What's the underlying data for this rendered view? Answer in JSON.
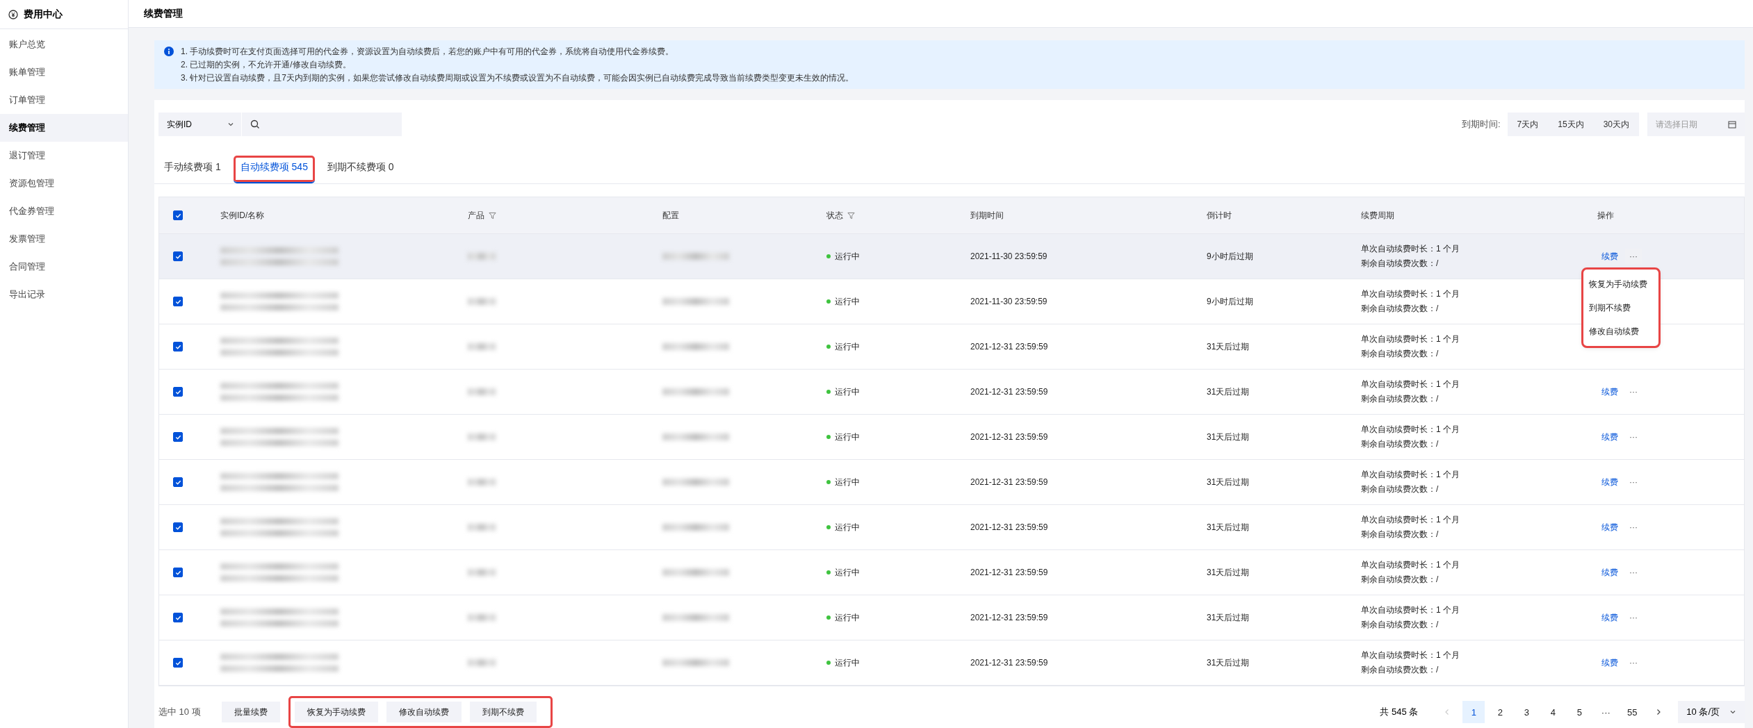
{
  "sidebar": {
    "title": "费用中心",
    "items": [
      {
        "label": "账户总览",
        "selected": false
      },
      {
        "label": "账单管理",
        "selected": false
      },
      {
        "label": "订单管理",
        "selected": false
      },
      {
        "label": "续费管理",
        "selected": true
      },
      {
        "label": "退订管理",
        "selected": false
      },
      {
        "label": "资源包管理",
        "selected": false
      },
      {
        "label": "代金券管理",
        "selected": false
      },
      {
        "label": "发票管理",
        "selected": false
      },
      {
        "label": "合同管理",
        "selected": false
      },
      {
        "label": "导出记录",
        "selected": false
      }
    ]
  },
  "header": {
    "title": "续费管理"
  },
  "notice": [
    "1. 手动续费时可在支付页面选择可用的代金券，资源设置为自动续费后，若您的账户中有可用的代金券，系统将自动使用代金券续费。",
    "2. 已过期的实例，不允许开通/修改自动续费。",
    "3. 针对已设置自动续费，且7天内到期的实例，如果您尝试修改自动续费周期或设置为不续费或设置为不自动续费，可能会因实例已自动续费完成导致当前续费类型变更未生效的情况。"
  ],
  "search": {
    "field": "实例ID"
  },
  "expiry_filter": {
    "label": "到期时间:",
    "options": [
      {
        "label": "7天内",
        "selected": false
      },
      {
        "label": "15天内",
        "selected": false
      },
      {
        "label": "30天内",
        "selected": false
      }
    ],
    "date_placeholder": "请选择日期"
  },
  "tabs": [
    {
      "label": "手动续费项 1",
      "selected": false,
      "highlighted": false
    },
    {
      "label": "自动续费项 545",
      "selected": true,
      "highlighted": true
    },
    {
      "label": "到期不续费项 0",
      "selected": false,
      "highlighted": false
    }
  ],
  "table": {
    "all_checked": true,
    "columns": [
      {
        "label": "实例ID/名称",
        "filter": false
      },
      {
        "label": "产品",
        "filter": true
      },
      {
        "label": "配置",
        "filter": false
      },
      {
        "label": "状态",
        "filter": true
      },
      {
        "label": "到期时间",
        "filter": false
      },
      {
        "label": "倒计时",
        "filter": false
      },
      {
        "label": "续费周期",
        "filter": false
      },
      {
        "label": "操作",
        "filter": false
      }
    ],
    "rows": [
      {
        "checked": true,
        "hovered": true,
        "status": "运行中",
        "color": "#3fc33f",
        "expires": "2021-11-30 23:59:59",
        "countdown": "9小时后过期",
        "cycle": [
          "单次自动续费时长：1 个月",
          "剩余自动续费次数：/"
        ],
        "action": "续费",
        "more": "···"
      },
      {
        "checked": true,
        "hovered": false,
        "status": "运行中",
        "color": "#3fc33f",
        "expires": "2021-11-30 23:59:59",
        "countdown": "9小时后过期",
        "cycle": [
          "单次自动续费时长：1 个月",
          "剩余自动续费次数：/"
        ]
      },
      {
        "checked": true,
        "hovered": false,
        "status": "运行中",
        "color": "#3fc33f",
        "expires": "2021-12-31 23:59:59",
        "countdown": "31天后过期",
        "cycle": [
          "单次自动续费时长：1 个月",
          "剩余自动续费次数：/"
        ]
      },
      {
        "checked": true,
        "hovered": false,
        "status": "运行中",
        "color": "#3fc33f",
        "expires": "2021-12-31 23:59:59",
        "countdown": "31天后过期",
        "cycle": [
          "单次自动续费时长：1 个月",
          "剩余自动续费次数：/"
        ],
        "action": "续费",
        "more": "···"
      },
      {
        "checked": true,
        "hovered": false,
        "status": "运行中",
        "color": "#3fc33f",
        "expires": "2021-12-31 23:59:59",
        "countdown": "31天后过期",
        "cycle": [
          "单次自动续费时长：1 个月",
          "剩余自动续费次数：/"
        ],
        "action": "续费",
        "more": "···"
      },
      {
        "checked": true,
        "hovered": false,
        "status": "运行中",
        "color": "#3fc33f",
        "expires": "2021-12-31 23:59:59",
        "countdown": "31天后过期",
        "cycle": [
          "单次自动续费时长：1 个月",
          "剩余自动续费次数：/"
        ],
        "action": "续费",
        "more": "···"
      },
      {
        "checked": true,
        "hovered": false,
        "status": "运行中",
        "color": "#3fc33f",
        "expires": "2021-12-31 23:59:59",
        "countdown": "31天后过期",
        "cycle": [
          "单次自动续费时长：1 个月",
          "剩余自动续费次数：/"
        ],
        "action": "续费",
        "more": "···"
      },
      {
        "checked": true,
        "hovered": false,
        "status": "运行中",
        "color": "#3fc33f",
        "expires": "2021-12-31 23:59:59",
        "countdown": "31天后过期",
        "cycle": [
          "单次自动续费时长：1 个月",
          "剩余自动续费次数：/"
        ],
        "action": "续费",
        "more": "···"
      },
      {
        "checked": true,
        "hovered": false,
        "status": "运行中",
        "color": "#3fc33f",
        "expires": "2021-12-31 23:59:59",
        "countdown": "31天后过期",
        "cycle": [
          "单次自动续费时长：1 个月",
          "剩余自动续费次数：/"
        ],
        "action": "续费",
        "more": "···"
      },
      {
        "checked": true,
        "hovered": false,
        "status": "运行中",
        "color": "#3fc33f",
        "expires": "2021-12-31 23:59:59",
        "countdown": "31天后过期",
        "cycle": [
          "单次自动续费时长：1 个月",
          "剩余自动续费次数：/"
        ],
        "action": "续费",
        "more": "···"
      }
    ]
  },
  "more_menu": {
    "highlighted": true,
    "items": [
      "恢复为手动续费",
      "到期不续费",
      "修改自动续费"
    ]
  },
  "footer": {
    "selected_count": "选中 10 项",
    "bulk_renew": "批量续费",
    "bulk_actions": {
      "highlighted": true,
      "buttons": [
        "恢复为手动续费",
        "修改自动续费",
        "到期不续费"
      ]
    }
  },
  "pagination": {
    "total": "共 545 条",
    "prev_disabled": true,
    "pages": [
      {
        "label": "1",
        "selected": true
      },
      {
        "label": "2",
        "selected": false
      },
      {
        "label": "3",
        "selected": false
      },
      {
        "label": "4",
        "selected": false
      },
      {
        "label": "5",
        "selected": false
      },
      {
        "label": "···",
        "selected": false
      },
      {
        "label": "55",
        "selected": false
      }
    ],
    "page_size": "10 条/页"
  }
}
